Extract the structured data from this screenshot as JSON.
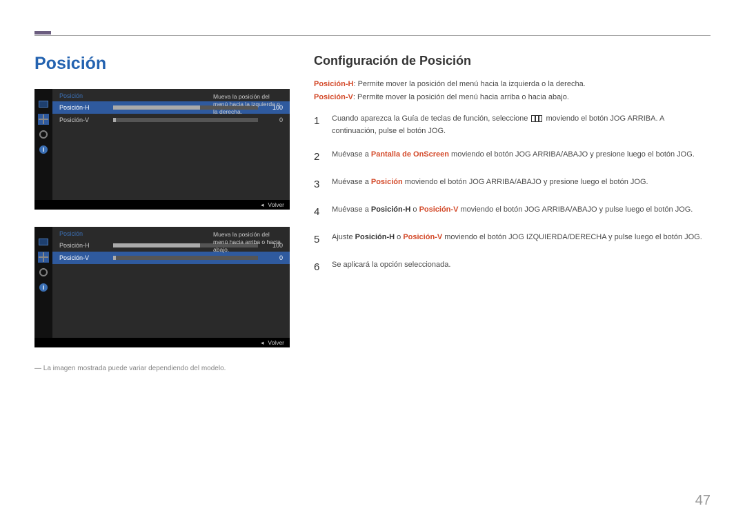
{
  "page_title": "Posición",
  "section_title": "Configuración de Posición",
  "intro": {
    "h_label": "Posición-H",
    "h_text": ": Permite mover la posición del menú hacia la izquierda o la derecha.",
    "v_label": "Posición-V",
    "v_text": ": Permite mover la posición del menú hacia arriba o hacia abajo."
  },
  "steps": [
    {
      "num": "1",
      "pre": "Cuando aparezca la Guía de teclas de función, seleccione ",
      "post": " moviendo el botón JOG ARRIBA. A continuación, pulse el botón JOG.",
      "icon": true
    },
    {
      "num": "2",
      "pre": "Muévase a ",
      "term": "Pantalla de OnScreen",
      "post": " moviendo el botón JOG ARRIBA/ABAJO y presione luego el botón JOG."
    },
    {
      "num": "3",
      "pre": "Muévase a ",
      "term": "Posición",
      "post": " moviendo el botón JOG ARRIBA/ABAJO y presione luego el botón JOG."
    },
    {
      "num": "4",
      "pre": "Muévase a ",
      "bold1": "Posición-H",
      "mid": " o ",
      "term": "Posición-V",
      "post": " moviendo el botón JOG ARRIBA/ABAJO y pulse luego el botón JOG."
    },
    {
      "num": "5",
      "pre": "Ajuste ",
      "bold1": "Posición-H",
      "mid": " o ",
      "term": "Posición-V",
      "post": " moviendo el botón JOG IZQUIERDA/DERECHA y pulse luego el botón JOG."
    },
    {
      "num": "6",
      "pre": "Se aplicará la opción seleccionada."
    }
  ],
  "osd": {
    "title": "Posición",
    "rows": [
      {
        "label": "Posición-H",
        "value": "100",
        "fill": 60
      },
      {
        "label": "Posición-V",
        "value": "0",
        "fill": 2
      }
    ],
    "hint_h": "Mueva la posición del menú hacia la izquierda o la derecha.",
    "hint_v": "Mueva la posición del menú hacia arriba o hacia abajo.",
    "back": "Volver"
  },
  "footnote_prefix": "― ",
  "footnote": "La imagen mostrada puede variar dependiendo del modelo.",
  "page_number": "47"
}
